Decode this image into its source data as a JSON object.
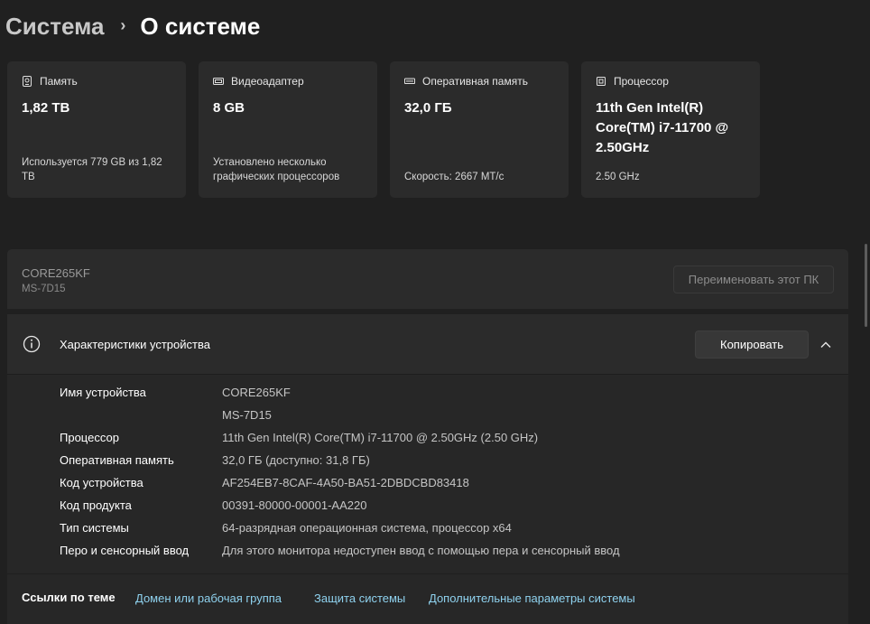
{
  "breadcrumb": {
    "parent": "Система",
    "separator": "›",
    "current": "О системе"
  },
  "cards": [
    {
      "icon": "storage-icon",
      "title": "Память",
      "value": "1,82 TB",
      "footer": "Используется 779 GB из 1,82 TB"
    },
    {
      "icon": "gpu-icon",
      "title": "Видеоадаптер",
      "value": "8 GB",
      "footer": "Установлено несколько графических процессоров"
    },
    {
      "icon": "ram-icon",
      "title": "Оперативная память",
      "value": "32,0 ГБ",
      "footer": "Скорость: 2667 МТ/с"
    },
    {
      "icon": "cpu-icon",
      "title": "Процессор",
      "value": "11th Gen Intel(R) Core(TM) i7-11700 @ 2.50GHz",
      "footer": "2.50 GHz"
    }
  ],
  "device": {
    "name": "CORE265KF",
    "model": "MS-7D15",
    "rename_label": "Переименовать этот ПК"
  },
  "specs": {
    "title": "Характеристики устройства",
    "copy_label": "Копировать",
    "rows": [
      {
        "label": "Имя устройства",
        "value": "CORE265KF"
      },
      {
        "label": "",
        "value": "MS-7D15"
      },
      {
        "label": "Процессор",
        "value": "11th Gen Intel(R) Core(TM) i7-11700 @ 2.50GHz (2.50 GHz)"
      },
      {
        "label": "Оперативная память",
        "value": "32,0 ГБ (доступно: 31,8 ГБ)"
      },
      {
        "label": "Код устройства",
        "value": "AF254EB7-8CAF-4A50-BA51-2DBDCBD83418"
      },
      {
        "label": "Код продукта",
        "value": "00391-80000-00001-AA220"
      },
      {
        "label": "Тип системы",
        "value": "64-разрядная операционная система, процессор x64"
      },
      {
        "label": "Перо и сенсорный ввод",
        "value": "Для этого монитора недоступен ввод с помощью пера и сенсорный ввод"
      }
    ]
  },
  "related": {
    "title": "Ссылки по теме",
    "links": [
      "Домен или рабочая группа",
      "Защита системы",
      "Дополнительные параметры системы"
    ]
  },
  "colors": {
    "background": "#202020",
    "card": "#2b2b2b",
    "link": "#8fd2ef"
  }
}
